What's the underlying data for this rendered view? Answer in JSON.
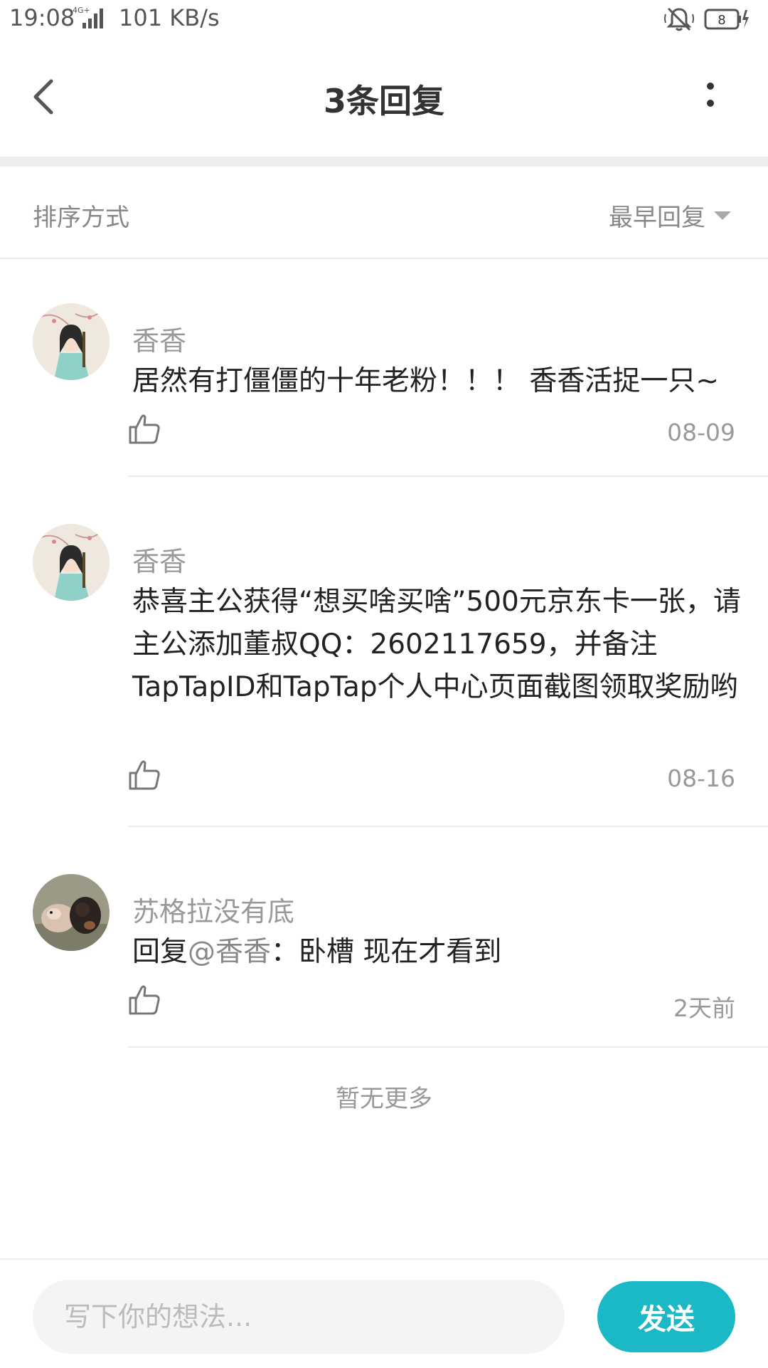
{
  "status_bar": {
    "time": "19:08",
    "network": "4G+",
    "speed": "101 KB/s",
    "battery": "8"
  },
  "header": {
    "title": "3条回复"
  },
  "sort": {
    "label": "排序方式",
    "value": "最早回复"
  },
  "comments": [
    {
      "user": "香香",
      "text": "居然有打僵僵的十年老粉！！！ 香香活捉一只~",
      "date": "08-09",
      "avatar": "avatar-girl"
    },
    {
      "user": "香香",
      "text": "恭喜主公获得“想买啥买啥”500元京东卡一张，请主公添加董叔QQ：2602117659，并备注TapTapID和TapTap个人中心页面截图领取奖励哟",
      "date": "08-16",
      "avatar": "avatar-girl"
    },
    {
      "user": "苏格拉没有底",
      "reply_prefix": "回复",
      "mention": "@香香",
      "text": "：卧槽 现在才看到",
      "date": "2天前",
      "avatar": "avatar-dogs"
    }
  ],
  "footer_note": "暂无更多",
  "composer": {
    "placeholder": "写下你的想法...",
    "send_label": "发送"
  },
  "colors": {
    "accent": "#1bb8c6",
    "divider": "#eeeeee",
    "muted_text": "#999999"
  }
}
